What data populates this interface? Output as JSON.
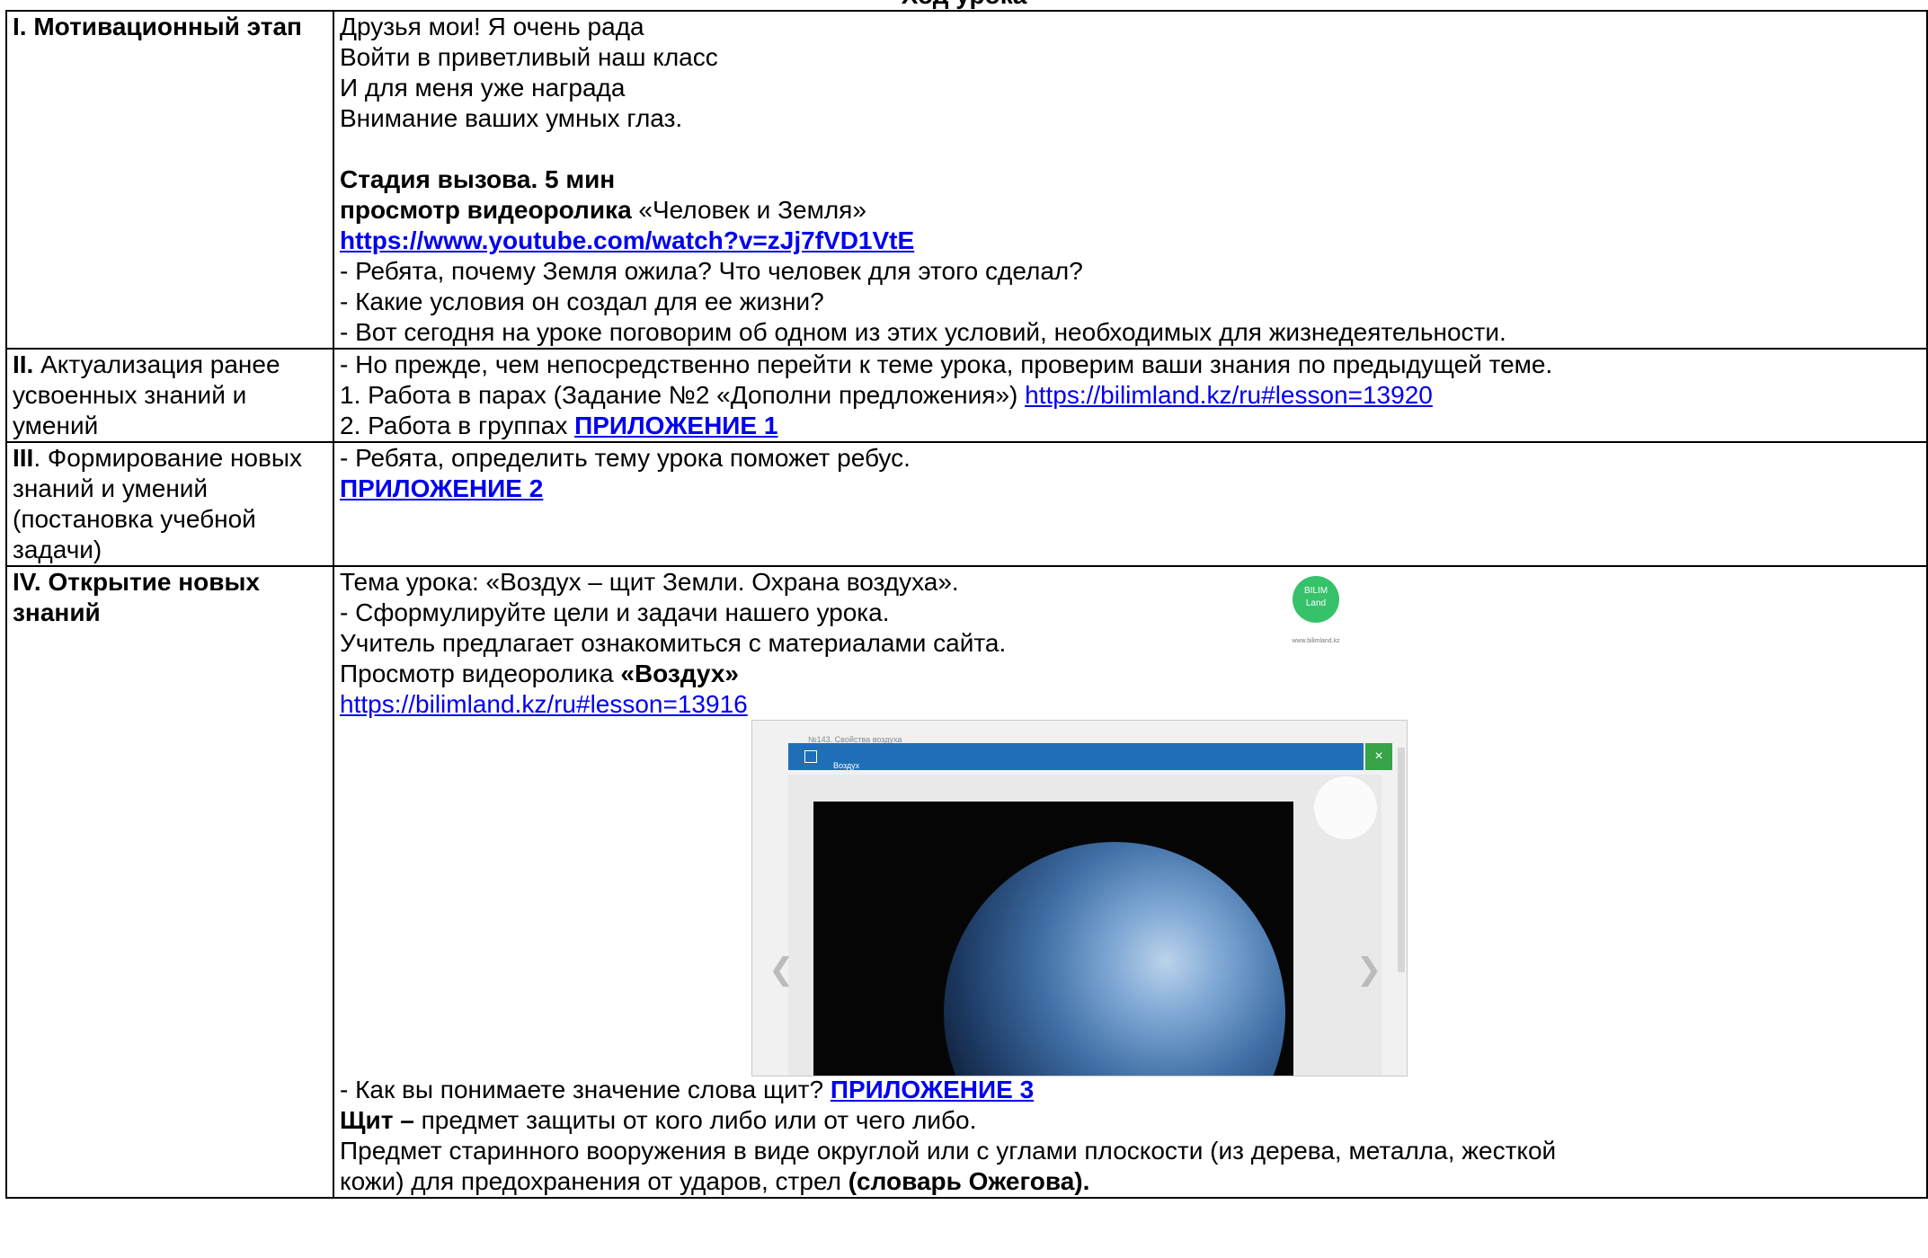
{
  "page": {
    "title": "Ход урока"
  },
  "rows": [
    {
      "stage": {
        "bold": "I. Мотивационный этап",
        "rest": ""
      },
      "lines": [
        "Друзья мои! Я очень рада",
        "Войти в приветливый наш класс",
        "И для меня уже награда",
        "Внимание ваших умных глаз."
      ],
      "challenge_title": "Стадия вызова. 5 мин",
      "video_label_bold": "просмотр видеоролика",
      "video_label_rest": " «Человек и Земля»",
      "video_link": " https://www.youtube.com/watch?v=zJj7fVD1VtE",
      "questions": [
        "- Ребята, почему Земля ожила? Что человек для этого сделал?",
        "- Какие условия он создал для ее жизни?",
        "- Вот сегодня на уроке поговорим об одном из этих условий, необходимых для жизнедеятельности."
      ]
    },
    {
      "stage": {
        "bold": "II.",
        "rest": " Актуализация ранее усвоенных знаний и умений"
      },
      "line1": "- Но прежде, чем непосредственно перейти к теме урока, проверим ваши знания по предыдущей теме.",
      "line2_text": "1. Работа в парах (Задание №2 «Дополни предложения») ",
      "line2_link": "https://bilimland.kz/ru#lesson=13920",
      "line3_text": "2. Работа в группах ",
      "line3_link": "ПРИЛОЖЕНИЕ 1"
    },
    {
      "stage": {
        "bold": "III",
        "rest": ". Формирование новых знаний и умений (постановка учебной задачи)"
      },
      "line1": "- Ребята, определить тему урока поможет ребус.",
      "link": "ПРИЛОЖЕНИЕ 2"
    },
    {
      "stage": {
        "bold": "IV. Открытие новых знаний",
        "rest": ""
      },
      "lines": [
        "Тема урока: «Воздух – щит Земли. Охрана воздуха».",
        "- Сформулируйте цели и задачи нашего урока.",
        "Учитель предлагает ознакомиться с материалами сайта."
      ],
      "video_text": "Просмотр видеоролика ",
      "video_bold": "«Воздух»",
      "video_link": "https://bilimland.kz/ru#lesson=13916",
      "logo": {
        "line1": "BILIM",
        "line2": "Land",
        "caption": "www.bilimland.kz"
      },
      "screenshot": {
        "crumb": "№143. Свойства воздуха",
        "bar_title": "Воздух",
        "close": "×"
      },
      "question_text": "- Как вы понимаете значение слова щит? ",
      "question_link": "ПРИЛОЖЕНИЕ 3",
      "def_bold": "Щит –",
      "def_rest": " предмет защиты от кого либо или от чего либо.",
      "def2": "Предмет старинного вооружения в виде округлой или с углами плоскости (из дерева, металла, жесткой",
      "def3_text": "кожи) для предохранения от ударов, стрел ",
      "def3_bold": "(словарь Ожегова)."
    }
  ]
}
